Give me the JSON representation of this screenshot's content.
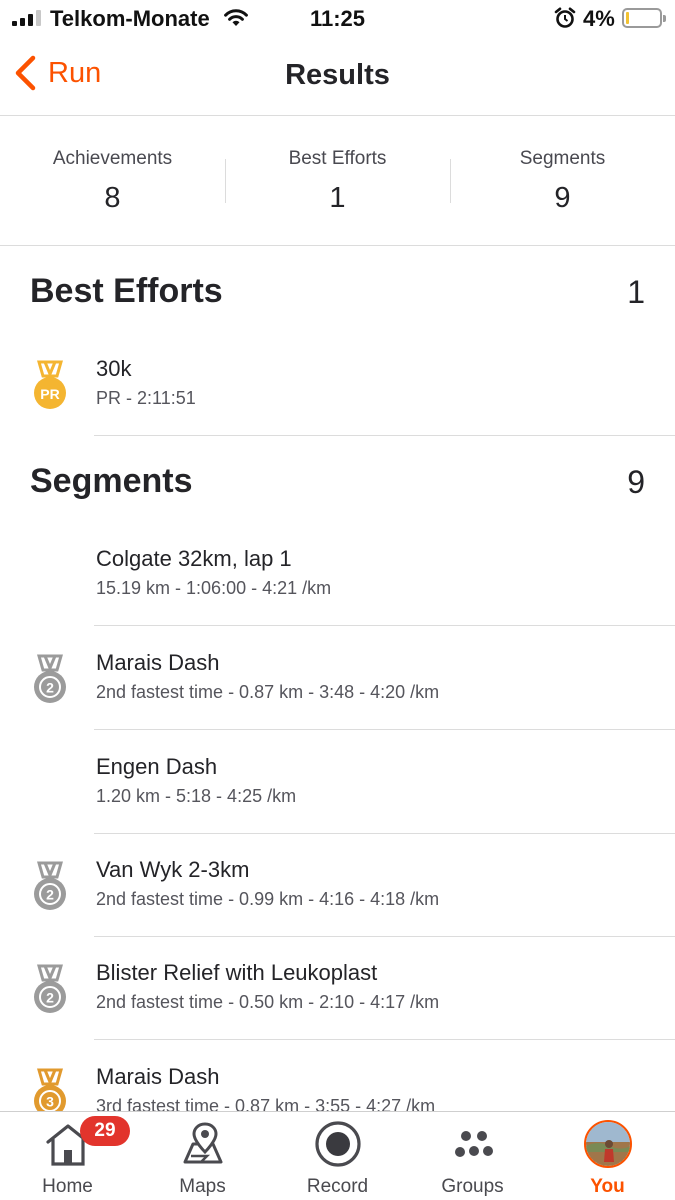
{
  "status_bar": {
    "carrier": "Telkom-Monate",
    "time": "11:25",
    "battery_pct": "4%",
    "battery_level": 0.04
  },
  "nav": {
    "back_label": "Run",
    "title": "Results"
  },
  "summary": [
    {
      "label": "Achievements",
      "value": "8"
    },
    {
      "label": "Best Efforts",
      "value": "1"
    },
    {
      "label": "Segments",
      "value": "9"
    }
  ],
  "best_efforts": {
    "title": "Best Efforts",
    "count": "1",
    "items": [
      {
        "name": "30k",
        "detail": "PR - 2:11:51",
        "badge": "pr-medal-icon"
      }
    ]
  },
  "segments": {
    "title": "Segments",
    "count": "9",
    "items": [
      {
        "name": "Colgate 32km, lap 1",
        "detail": "15.19 km - 1:06:00 - 4:21 /km",
        "badge": ""
      },
      {
        "name": "Marais Dash",
        "detail": "2nd fastest time - 0.87 km - 3:48 - 4:20 /km",
        "badge": "silver-medal-2-icon"
      },
      {
        "name": "Engen Dash",
        "detail": "1.20 km - 5:18 - 4:25 /km",
        "badge": ""
      },
      {
        "name": "Van Wyk 2-3km",
        "detail": "2nd fastest time - 0.99 km - 4:16 - 4:18 /km",
        "badge": "silver-medal-2-icon"
      },
      {
        "name": "Blister Relief with Leukoplast",
        "detail": "2nd fastest time - 0.50 km - 2:10 - 4:17 /km",
        "badge": "silver-medal-2-icon"
      },
      {
        "name": "Marais Dash",
        "detail": "3rd fastest time - 0.87 km - 3:55 - 4:27 /km",
        "badge": "bronze-medal-3-icon"
      }
    ]
  },
  "tabs": [
    {
      "label": "Home",
      "icon": "home-icon",
      "badge": "29"
    },
    {
      "label": "Maps",
      "icon": "maps-icon"
    },
    {
      "label": "Record",
      "icon": "record-icon"
    },
    {
      "label": "Groups",
      "icon": "groups-icon"
    },
    {
      "label": "You",
      "icon": "avatar",
      "active": true
    }
  ],
  "colors": {
    "accent": "#fc5200",
    "pr_gold": "#f4b531",
    "silver": "#9b9b9b",
    "bronze": "#e19a2e",
    "notification": "#e2342c"
  }
}
